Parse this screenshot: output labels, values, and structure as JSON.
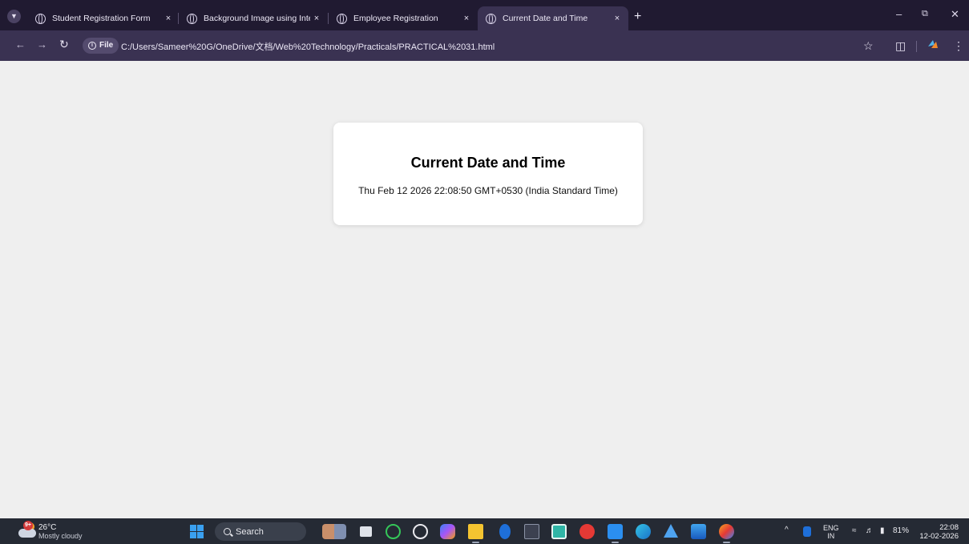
{
  "browser": {
    "tabs": [
      {
        "title": "Student Registration Form"
      },
      {
        "title": "Background Image using Intern"
      },
      {
        "title": "Employee Registration"
      },
      {
        "title": "Current Date and Time"
      }
    ],
    "active_tab_index": 3,
    "close_glyph": "×",
    "new_tab_glyph": "+",
    "address": {
      "chip_label": "File",
      "url": "C:/Users/Sameer%20G/OneDrive/文档/Web%20Technology/Practicals/PRACTICAL%2031.html"
    },
    "icons": [
      "tab-search-icon",
      "back-icon",
      "forward-icon",
      "reload-icon",
      "info-icon",
      "bookmark-star-icon",
      "extensions-icon",
      "profile-icon",
      "menu-icon",
      "minimize-icon",
      "restore-icon",
      "close-icon"
    ]
  },
  "page": {
    "heading": "Current Date and Time",
    "datetime": "Thu Feb 12 2026 22:08:50 GMT+0530 (India Standard Time)"
  },
  "taskbar": {
    "weather": {
      "badge": "9+",
      "temperature": "26°C",
      "condition": "Mostly cloudy"
    },
    "search_label": "Search",
    "language": {
      "line1": "ENG",
      "line2": "IN"
    },
    "battery": "81%",
    "clock": {
      "time": "22:08",
      "date": "12-02-2026"
    },
    "apps": [
      "widgets-icon",
      "task-view-icon",
      "whatsapp-icon",
      "chatgpt-icon",
      "copilot-icon",
      "file-explorer-icon",
      "bluetooth-icon",
      "terminal-icon",
      "photos-icon",
      "opera-icon",
      "vscode-icon",
      "edge-icon",
      "ai-assistant-icon",
      "word-icon",
      "browser-icon"
    ],
    "colors": {
      "accent": "#3aa0f0",
      "taskbar": "#252a34",
      "tab_strip": "#201a31",
      "toolbar": "#3a3252"
    }
  }
}
